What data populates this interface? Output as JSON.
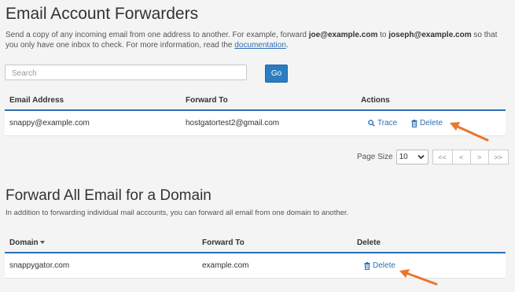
{
  "forwarders": {
    "title": "Email Account Forwarders",
    "desc_part1": "Send a copy of any incoming email from one address to another. For example, forward ",
    "desc_email1": "joe@example.com",
    "desc_to": " to ",
    "desc_email2": "joseph@example.com",
    "desc_part2": " so that you only have one inbox to check. For more information, read the ",
    "desc_link": "documentation",
    "desc_end": ".",
    "search_placeholder": "Search",
    "go_label": "Go",
    "columns": {
      "email": "Email Address",
      "forward": "Forward To",
      "actions": "Actions"
    },
    "rows": [
      {
        "email": "snappy@example.com",
        "forward_to": "hostgatortest2@gmail.com",
        "trace_label": "Trace",
        "delete_label": "Delete"
      }
    ],
    "pagination": {
      "page_size_label": "Page Size",
      "page_size_value": "10",
      "first": "<<",
      "prev": "<",
      "next": ">",
      "last": ">>"
    }
  },
  "domain_forward": {
    "title": "Forward All Email for a Domain",
    "desc": "In addition to forwarding individual mail accounts, you can forward all email from one domain to another.",
    "columns": {
      "domain": "Domain",
      "forward": "Forward To",
      "delete": "Delete"
    },
    "rows": [
      {
        "domain": "snappygator.com",
        "forward_to": "example.com",
        "delete_label": "Delete"
      }
    ]
  },
  "colors": {
    "accent": "#2c6fb7",
    "button": "#2c7cc2",
    "arrow": "#e8762b"
  },
  "icons": [
    "search-icon",
    "trash-icon",
    "sort-down-icon",
    "chevron-down-icon",
    "arrow-annotation"
  ]
}
